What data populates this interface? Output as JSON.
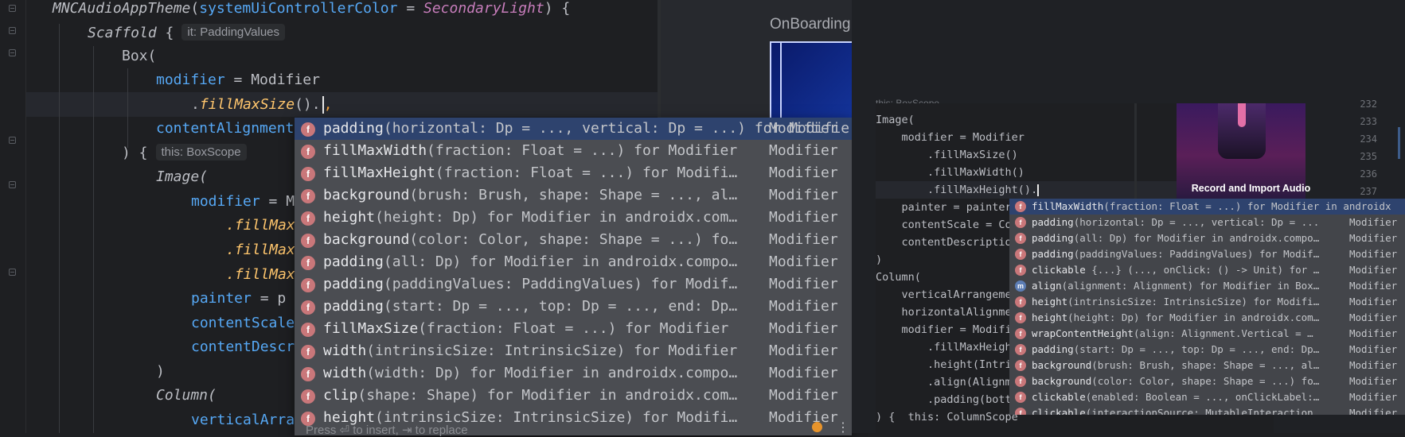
{
  "left_editor": {
    "lines": [
      {
        "a": "MNCAudioAppTheme",
        "b": "(",
        "c": "systemUiControllerColor",
        "d": " = ",
        "e": "SecondaryLight",
        "f": ") {"
      },
      {
        "a": "Scaffold",
        " b": " {",
        "hint": "it: PaddingValues"
      },
      {
        "a": "Box("
      },
      {
        "a": "modifier",
        "b": " = Modifier"
      },
      {
        "a": ".",
        "b": "fillMaxSize",
        "c": "()."
      },
      {
        "a": "contentAlignment"
      },
      {
        "a": ") {",
        "hint": "this: BoxScope"
      },
      {
        "a": "Image("
      },
      {
        "a": "modifier",
        "b": " = M"
      },
      {
        "a": ".fillMax"
      },
      {
        "a": ".fillMax"
      },
      {
        "a": ".fillMax"
      },
      {
        "a": "painter",
        "b": " = p"
      },
      {
        "a": "contentScale"
      },
      {
        "a": "contentDescr"
      },
      {
        "a": ")"
      },
      {
        "a": "Column("
      },
      {
        "a": "verticalArra"
      }
    ],
    "scaffold_hint": "it: PaddingValues",
    "box_hint": "this: BoxScope",
    "preview_title": "OnBoarding"
  },
  "left_popup": {
    "items": [
      {
        "name": "padding",
        "sig": "(horizontal: Dp = ..., vertical: Dp = ...) for Modifier",
        "type": "Modifier",
        "selected": true
      },
      {
        "name": "fillMaxWidth",
        "sig": "(fraction: Float = ...) for Modifier",
        "type": "Modifier"
      },
      {
        "name": "fillMaxHeight",
        "sig": "(fraction: Float = ...) for Modifi…",
        "type": "Modifier"
      },
      {
        "name": "background",
        "sig": "(brush: Brush, shape: Shape = ..., al…",
        "type": "Modifier"
      },
      {
        "name": "height",
        "sig": "(height: Dp) for Modifier in androidx.com…",
        "type": "Modifier"
      },
      {
        "name": "background",
        "sig": "(color: Color, shape: Shape = ...) fo…",
        "type": "Modifier"
      },
      {
        "name": "padding",
        "sig": "(all: Dp) for Modifier in androidx.compo…",
        "type": "Modifier"
      },
      {
        "name": "padding",
        "sig": "(paddingValues: PaddingValues) for Modif…",
        "type": "Modifier"
      },
      {
        "name": "padding",
        "sig": "(start: Dp = ..., top: Dp = ..., end: Dp…",
        "type": "Modifier"
      },
      {
        "name": "fillMaxSize",
        "sig": "(fraction: Float = ...) for Modifier",
        "type": "Modifier"
      },
      {
        "name": "width",
        "sig": "(intrinsicSize: IntrinsicSize) for Modifier",
        "type": "Modifier"
      },
      {
        "name": "width",
        "sig": "(width: Dp) for Modifier in androidx.compo…",
        "type": "Modifier"
      },
      {
        "name": "clip",
        "sig": "(shape: Shape) for Modifier in androidx.com…",
        "type": "Modifier"
      },
      {
        "name": "height",
        "sig": "(intrinsicSize: IntrinsicSize) for Modifi…",
        "type": "Modifier"
      }
    ],
    "badge": "f",
    "hint_text": "Press ⏎ to insert, ⇥ to replace",
    "menu_glyph": "⋮"
  },
  "right_editor": {
    "scope_label": "this: BoxScope",
    "lines": [
      "Image(",
      "    modifier = Modifier",
      "        .fillMaxSize()",
      "        .fillMaxWidth()",
      "        .fillMaxHeight().",
      "    painter = painterR",
      "    contentScale = Con",
      "    contentDescription",
      ")",
      "Column(",
      "    verticalArrangemen",
      "    horizontalAlignmen",
      "    modifier = Modifie",
      "        .fillMaxHeight",
      "        .height(Intrin",
      "        .align(Alignme",
      "        .padding(botto",
      ") {  this: ColumnScope"
    ],
    "preview_label": "Record and Import Audio",
    "line_numbers": [
      "232",
      "233",
      "234",
      "235",
      "236",
      "237"
    ]
  },
  "right_popup": {
    "items": [
      {
        "badge": "f",
        "name": "fillMaxWidth",
        "sig": "(fraction: Float = ...) for Modifier in androidx",
        "type": "",
        "selected": true
      },
      {
        "badge": "f",
        "name": "padding",
        "sig": "(horizontal: Dp = ..., vertical: Dp = ...",
        "type": "Modifier"
      },
      {
        "badge": "f",
        "name": "padding",
        "sig": "(all: Dp) for Modifier in androidx.compo…",
        "type": "Modifier"
      },
      {
        "badge": "f",
        "name": "padding",
        "sig": "(paddingValues: PaddingValues) for Modif…",
        "type": "Modifier"
      },
      {
        "badge": "f",
        "name": "clickable",
        "sig": " {...} (..., onClick: () -> Unit) for …",
        "type": "Modifier"
      },
      {
        "badge": "m",
        "name": "align",
        "sig": "(alignment: Alignment) for Modifier in Box…",
        "type": "Modifier"
      },
      {
        "badge": "f",
        "name": "height",
        "sig": "(intrinsicSize: IntrinsicSize) for Modifi…",
        "type": "Modifier"
      },
      {
        "badge": "f",
        "name": "height",
        "sig": "(height: Dp) for Modifier in androidx.com…",
        "type": "Modifier"
      },
      {
        "badge": "f",
        "name": "wrapContentHeight",
        "sig": "(align: Alignment.Vertical = …",
        "type": "Modifier"
      },
      {
        "badge": "f",
        "name": "padding",
        "sig": "(start: Dp = ..., top: Dp = ..., end: Dp…",
        "type": "Modifier"
      },
      {
        "badge": "f",
        "name": "background",
        "sig": "(brush: Brush, shape: Shape = ..., al…",
        "type": "Modifier"
      },
      {
        "badge": "f",
        "name": "background",
        "sig": "(color: Color, shape: Shape = ...) fo…",
        "type": "Modifier"
      },
      {
        "badge": "f",
        "name": "clickable",
        "sig": "(enabled: Boolean = ..., onClickLabel:…",
        "type": "Modifier"
      },
      {
        "badge": "f",
        "name": "clickable",
        "sig": "(interactionSource: MutableInteraction…",
        "type": "Modifier"
      }
    ]
  },
  "colors": {
    "selection": "#2e436e",
    "badge_function": "#c9777a",
    "accent_orange": "#e8942b"
  }
}
